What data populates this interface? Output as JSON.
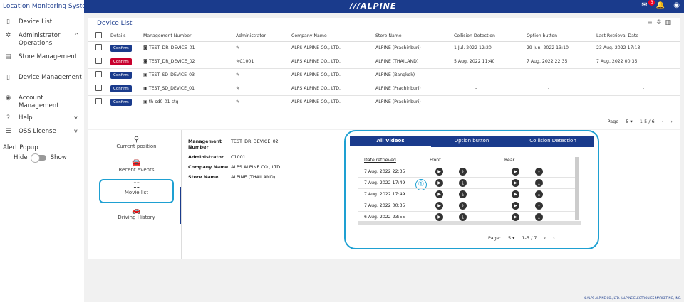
{
  "app": {
    "title": "Location Monitoring System",
    "brand": "///ALPINE",
    "footer": "©ALPS ALPINE CO., LTD. /ALPINE ELECTRONICS MARKETING, INC.",
    "notification_count": "3"
  },
  "sidebar": {
    "items": [
      {
        "label": "Device List",
        "icon": "tablet-icon"
      },
      {
        "label": "Administrator Operations",
        "icon": "gear-icon",
        "chevron": "^"
      },
      {
        "label": "Store Management",
        "icon": "store-icon"
      },
      {
        "label": "Device Management",
        "icon": "device-icon"
      },
      {
        "label": "Account Management",
        "icon": "account-icon"
      },
      {
        "label": "Help",
        "icon": "help-icon",
        "chevron": "v"
      },
      {
        "label": "OSS License",
        "icon": "list-icon",
        "chevron": "v"
      }
    ],
    "alert_title": "Alert Popup",
    "alert_hide": "Hide",
    "alert_show": "Show"
  },
  "device_list": {
    "title": "Device List",
    "columns": {
      "details": "Details",
      "management_number": "Management Number",
      "administrator": "Administrator",
      "company": "Company Name",
      "store": "Store Name",
      "collision": "Collision Detection",
      "option": "Option button",
      "last_retrieval": "Last Retrieval Date"
    },
    "confirm_label": "Confirm",
    "rows": [
      {
        "mgmt": "TEST_DR_DEVICE_01",
        "admin": "",
        "company": "ALPS ALPINE CO., LTD.",
        "store": "ALPINE (Prachinburi)",
        "collision": "1 Jul. 2022 12:20",
        "option": "29 Jun. 2022 13:10",
        "last": "23 Aug. 2022 17:13"
      },
      {
        "mgmt": "TEST_DR_DEVICE_02",
        "admin": "C1001",
        "company": "ALPS ALPINE CO., LTD.",
        "store": "ALPINE (THAILAND)",
        "collision": "5 Aug. 2022 11:40",
        "option": "7 Aug. 2022 22:35",
        "last": "7 Aug. 2022 00:35"
      },
      {
        "mgmt": "TEST_SD_DEVICE_03",
        "admin": "",
        "company": "ALPS ALPINE CO., LTD.",
        "store": "ALPINE (Bangkok)",
        "collision": "-",
        "option": "-",
        "last": "-"
      },
      {
        "mgmt": "TEST_SD_DEVICE_01",
        "admin": "",
        "company": "ALPS ALPINE CO., LTD.",
        "store": "ALPINE (Prachinburi)",
        "collision": "-",
        "option": "-",
        "last": "-"
      },
      {
        "mgmt": "th-sd0-01-stg",
        "admin": "",
        "company": "ALPS ALPINE CO., LTD.",
        "store": "ALPINE (Prachinburi)",
        "collision": "-",
        "option": "-",
        "last": "-"
      }
    ],
    "pager": {
      "page_label": "Page",
      "page_size": "5",
      "range": "1-5 / 6"
    }
  },
  "detail": {
    "menu": [
      {
        "label": "Current position",
        "icon": "pin-icon"
      },
      {
        "label": "Recent events",
        "icon": "car-alert-icon"
      },
      {
        "label": "Movie list",
        "icon": "movie-list-icon"
      },
      {
        "label": "Driving History",
        "icon": "car-icon"
      }
    ],
    "info": [
      {
        "key": "Management Number",
        "value": "TEST_DR_DEVICE_02"
      },
      {
        "key": "Administrator",
        "value": "C1001"
      },
      {
        "key": "Company Name",
        "value": "ALPS ALPINE CO., LTD."
      },
      {
        "key": "Store Name",
        "value": "ALPINE (THAILAND)"
      }
    ],
    "marker": "①"
  },
  "videos": {
    "tabs": [
      "All Videos",
      "Option button",
      "Collision Detection"
    ],
    "columns": {
      "date": "Date retrieved",
      "front": "Front",
      "rear": "Rear"
    },
    "rows": [
      "7 Aug. 2022 22:35",
      "7 Aug. 2022 17:49",
      "7 Aug. 2022 17:49",
      "7 Aug. 2022 00:35",
      "6 Aug. 2022 23:55"
    ],
    "pager": {
      "page_label": "Page:",
      "page_size": "5",
      "range": "1-5 / 7"
    }
  }
}
